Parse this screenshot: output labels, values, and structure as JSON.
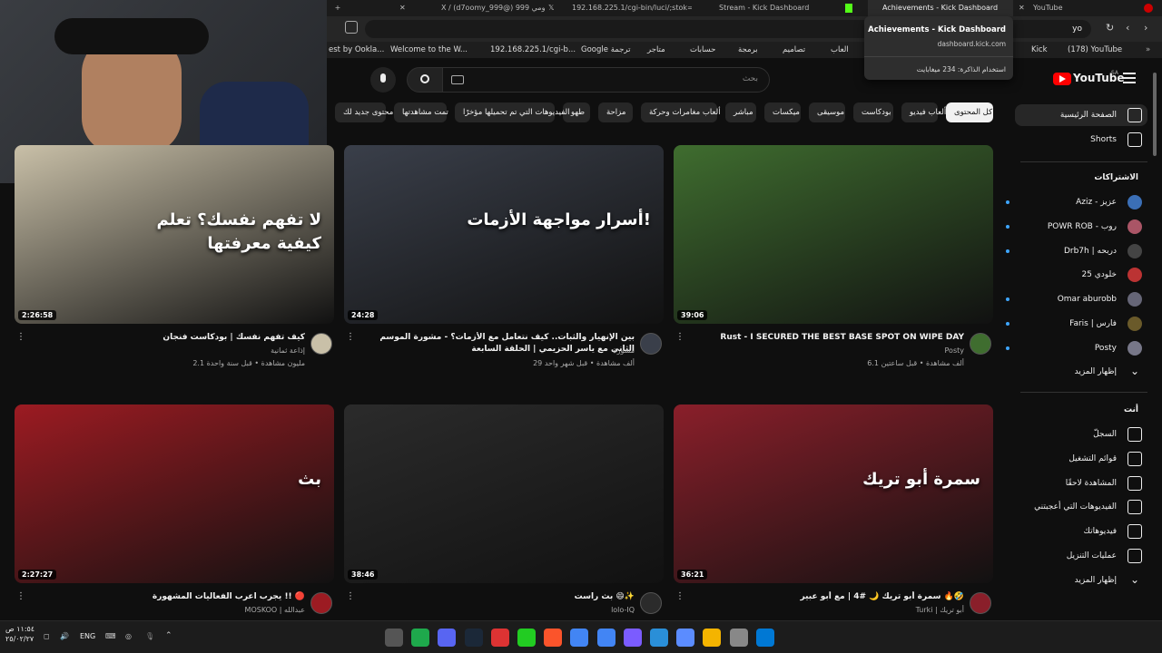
{
  "tabs": [
    {
      "label": "X / (d7oomy_999@) دحومي 999"
    },
    {
      "label": "192.168.225.1/cgi-bin/luci/;stok=592"
    },
    {
      "label": "Stream - Kick Dashboard"
    },
    {
      "label": "Achievements - Kick Dashboard"
    },
    {
      "label": "YouTube"
    }
  ],
  "address": {
    "value": "yo"
  },
  "bookmarks": [
    "est by Ookla...",
    "Welcome to the W...",
    "192.168.225.1/cgi-b...",
    "Google ترجمة",
    "متاجر",
    "حسابات",
    "برمجة",
    "تصاميم",
    "العاب",
    "Kick",
    "(178) YouTube"
  ],
  "popup": {
    "title": "Achievements - Kick Dashboard",
    "domain": "dashboard.kick.com",
    "memory": "استخدام الذاكرة: 234 ميغابايت"
  },
  "header": {
    "logo": "YouTube",
    "region": "SA",
    "search_placeholder": "بحث"
  },
  "chips": [
    "كل المحتوى",
    "ألعاب فيديو",
    "بودكاست",
    "موسيقى",
    "ميكسات",
    "مباشر",
    "ألعاب مغامرات وحركة",
    "مزاحة",
    "طهو",
    "الفيديوهات التي تم تحميلها مؤخرًا",
    "تمت مشاهدتها",
    "محتوى جديد لك"
  ],
  "sidebar": {
    "main": [
      {
        "label": "الصفحة الرئيسية",
        "icon": "home-icon"
      },
      {
        "label": "Shorts",
        "icon": "shorts-icon"
      }
    ],
    "subs_heading": "الاشتراكات",
    "subs": [
      {
        "label": "Aziz - عزيز",
        "color": "#3b6fb6"
      },
      {
        "label": "POWR ROB - روب",
        "color": "#a56"
      },
      {
        "label": "Drb7h | دربحه",
        "color": "#444"
      },
      {
        "label": "خلودي 25",
        "color": "#b33"
      },
      {
        "label": "Omar aburobb",
        "color": "#667"
      },
      {
        "label": "Faris | فارس",
        "color": "#6a5a2a"
      },
      {
        "label": "Posty",
        "color": "#778"
      }
    ],
    "show_more": "إظهار المزيد",
    "you_heading": "أنت",
    "you": [
      {
        "label": "السجلّ",
        "icon": "history-icon"
      },
      {
        "label": "قوائم التشغيل",
        "icon": "playlist-icon"
      },
      {
        "label": "المشاهدة لاحقًا",
        "icon": "clock-icon"
      },
      {
        "label": "الفيديوهات التي أعجبتني",
        "icon": "like-icon"
      },
      {
        "label": "فيديوهاتك",
        "icon": "video-icon"
      },
      {
        "label": "عمليات التنزيل",
        "icon": "download-icon"
      }
    ],
    "show_more2": "إظهار المزيد"
  },
  "videos": [
    {
      "title": "Rust - I SECURED THE BEST BASE SPOT ON WIPE DAY",
      "channel": "Posty",
      "meta": "6.1 ألف مشاهدة • قبل ساعتين",
      "duration": "39:06",
      "thumb": "#3f6d2f",
      "thumb_text": ""
    },
    {
      "title": "بين الإنهيار والثبات.. كيف نتعامل مع الأزمات؟ - مشورة الموسم الثاني مع ياسر الحزيمي | الحلقة السابعة",
      "channel": "مشورة",
      "meta": "29 ألف مشاهدة • قبل شهر واحد",
      "duration": "24:28",
      "thumb": "#3a3f4a",
      "thumb_text": "أسرار مواجهة الأزمات!"
    },
    {
      "title": "كيف تفهم نفسك | بودكاست فنجان",
      "channel": "إذاعة ثمانية",
      "meta": "2.1 مليون مشاهدة • قبل سنة واحدة",
      "duration": "2:26:58",
      "thumb": "#c9c0a8",
      "thumb_text": "لا تفهم نفسك؟ تعلم كيفية معرفتها"
    },
    {
      "title": "سمرة أبو تريك 🌙 #4 | مع أبو عبير 🔥🤣",
      "channel": "Turki | أبو تريك",
      "meta": "",
      "duration": "36:21",
      "thumb": "#8a1f2a",
      "thumb_text": "سمرة أبو تريك"
    },
    {
      "title": "بث راست 😄✨",
      "channel": "lolo-IQ",
      "meta": "",
      "duration": "38:46",
      "thumb": "#2b2b2b",
      "thumb_text": ""
    },
    {
      "title": "يجرب اعرب الفعاليات المشهورة !! 🔴",
      "channel": "MOSKOO | عبدالله",
      "meta": "",
      "duration": "2:27:27",
      "thumb": "#9c1b22",
      "thumb_text": "بث"
    }
  ],
  "taskbar": {
    "lang": "ENG",
    "time": "١١:٥٤ ص",
    "date": "٢٥/٠٢/٢٧"
  }
}
